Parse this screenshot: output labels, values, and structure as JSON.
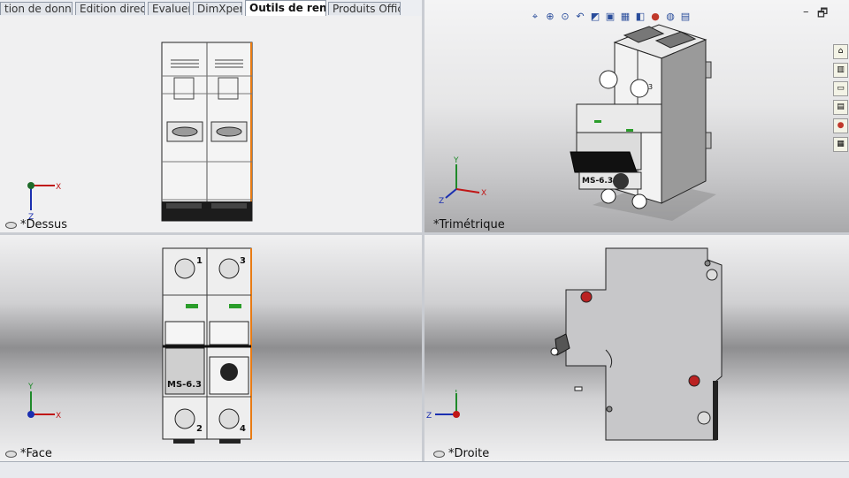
{
  "tabs": [
    {
      "label": "tion de données"
    },
    {
      "label": "Edition directe"
    },
    {
      "label": "Evaluer"
    },
    {
      "label": "DimXpert"
    },
    {
      "label": "Outils de rendu",
      "active": true
    },
    {
      "label": "Produits Office"
    }
  ],
  "viewports": {
    "top": {
      "label": "*Dessus"
    },
    "trimetric": {
      "label": "*Trimétrique"
    },
    "front": {
      "label": "*Face"
    },
    "right": {
      "label": "*Droite"
    }
  },
  "part": {
    "model_label": "MS-6.3",
    "terminals": [
      "1",
      "3",
      "2",
      "4"
    ]
  },
  "axes": {
    "x": "X",
    "y": "Y",
    "z": "Z"
  },
  "window_controls": {
    "minimize": "–",
    "restore": "🗗"
  },
  "hud_icons": [
    "zoom-fit-icon",
    "zoom-area-icon",
    "zoom-in-icon",
    "previous-view-icon",
    "section-view-icon",
    "view-orientation-icon",
    "display-style-icon",
    "hide-show-icon",
    "edit-appearance-icon",
    "apply-scene-icon",
    "view-settings-icon"
  ],
  "taskpane_icons": [
    "home-icon",
    "design-library-icon",
    "file-explorer-icon",
    "view-palette-icon",
    "appearances-icon",
    "custom-properties-icon"
  ],
  "colors": {
    "accent": "#2a4d9b",
    "viewport_bg": "#eeeeef",
    "selection": "#e87b14"
  }
}
